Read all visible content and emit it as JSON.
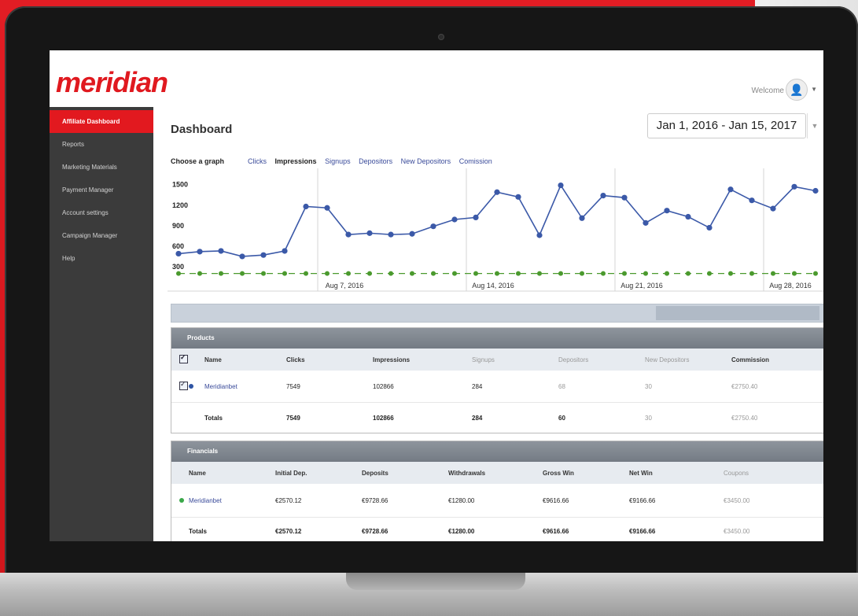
{
  "brand": {
    "logo": "meridian",
    "accent": "#e2191f"
  },
  "header": {
    "welcome": "Welcome"
  },
  "sidebar": {
    "items": [
      {
        "label": "Affiliate Dashboard",
        "active": true
      },
      {
        "label": "Reports"
      },
      {
        "label": "Marketing Materials"
      },
      {
        "label": "Payment Manager"
      },
      {
        "label": "Account settings"
      },
      {
        "label": "Campaign Manager"
      },
      {
        "label": "Help"
      }
    ]
  },
  "dashboard": {
    "title": "Dashboard",
    "date_range": "Jan 1, 2016 - Jan 15, 2017",
    "choose_label": "Choose a graph",
    "tabs": [
      {
        "label": "Clicks"
      },
      {
        "label": "Impressions",
        "selected": true
      },
      {
        "label": "Signups"
      },
      {
        "label": "Depositors"
      },
      {
        "label": "New Depositors"
      },
      {
        "label": "Comission"
      }
    ]
  },
  "chart_data": {
    "type": "line",
    "y_ticks": [
      "1500",
      "1200",
      "900",
      "600",
      "300"
    ],
    "ylim": [
      150,
      1600
    ],
    "x_labels": [
      "Aug 7, 2016",
      "Aug 14, 2016",
      "Aug 21, 2016",
      "Aug 28, 2016"
    ],
    "series": [
      {
        "color": "#3b59a8",
        "values": [
          490,
          520,
          530,
          450,
          470,
          530,
          1180,
          1160,
          770,
          790,
          770,
          780,
          890,
          990,
          1020,
          1390,
          1320,
          760,
          1490,
          1010,
          1340,
          1310,
          940,
          1120,
          1030,
          870,
          1430,
          1270,
          1150,
          1470,
          1410
        ]
      },
      {
        "color": "#4b9a2e",
        "values": [
          200,
          200,
          200,
          200,
          200,
          200,
          200,
          200,
          200,
          200,
          200,
          200,
          200,
          200,
          200,
          200,
          200,
          200,
          200,
          200,
          200,
          200,
          200,
          200,
          200,
          200,
          200,
          200,
          200,
          200,
          200
        ]
      }
    ]
  },
  "products": {
    "title": "Products",
    "headers": [
      "Name",
      "Clicks",
      "Impressions",
      "Signups",
      "Depositors",
      "New Depositors",
      "Commission"
    ],
    "row": {
      "name": "Meridianbet",
      "clicks": "7549",
      "impressions": "102866",
      "signups": "284",
      "depositors": "68",
      "new_depositors": "30",
      "commission": "€2750.40"
    },
    "totals": {
      "label": "Totals",
      "clicks": "7549",
      "impressions": "102866",
      "signups": "284",
      "depositors": "60",
      "new_depositors": "30",
      "commission": "€2750.40"
    }
  },
  "financials": {
    "title": "Financials",
    "headers": [
      "Name",
      "Initial Dep.",
      "Deposits",
      "Withdrawals",
      "Gross Win",
      "Net Win",
      "Coupons"
    ],
    "row": {
      "name": "Meridianbet",
      "initial_dep": "€2570.12",
      "deposits": "€9728.66",
      "withdrawals": "€1280.00",
      "gross_win": "€9616.66",
      "net_win": "€9166.66",
      "coupons": "€3450.00"
    },
    "totals": {
      "label": "Totals",
      "initial_dep": "€2570.12",
      "deposits": "€9728.66",
      "withdrawals": "€1280.00",
      "gross_win": "€9616.66",
      "net_win": "€9166.66",
      "coupons": "€3450.00"
    }
  }
}
